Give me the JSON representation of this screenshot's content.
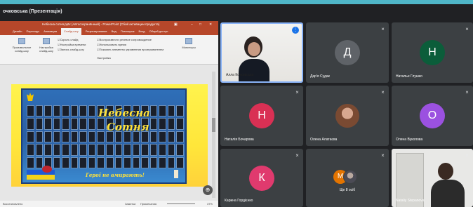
{
  "window": {
    "title": "очковська (Презентація)"
  },
  "powerpoint": {
    "title": "Небесна сотня.pptx (Автосохранённый) - PowerPoint (Сбой активации продукта)",
    "tabs": [
      "Дизайн",
      "Переходы",
      "Анимация",
      "Слайд-шоу",
      "Рецензирование",
      "Вид",
      "Помощник",
      "Вход",
      "Общий доступ"
    ],
    "active_tab": "Слайд-шоу",
    "ribbon": {
      "btn1": "Произвольное слайд-шоу",
      "btn2": "Настройка слайд-шоу",
      "hide_slide": "Скрыть слайд",
      "rehearse": "Настройка времени",
      "record": "Запись слайд-шоу",
      "narrations": "Воспроизвести речевое сопровождение",
      "timings": "Использовать время",
      "controls": "Показать элементы управления проигрывателем",
      "group": "Настройка",
      "monitors": "Мониторы"
    },
    "slide": {
      "caption1": "Небесна",
      "caption2": "Сотня",
      "footer": "Герої не вмирають!"
    },
    "status": {
      "ready": "Восстановлено",
      "notes": "Заметки",
      "comments": "Примечания",
      "zoom": "37%"
    }
  },
  "participants": [
    {
      "name": "Алла Кочковська",
      "type": "camera",
      "speaking": true
    },
    {
      "name": "Дар'я Судак",
      "type": "initial",
      "initial": "Д",
      "color": "#5f6368"
    },
    {
      "name": "Наталье Глушко",
      "type": "initial",
      "initial": "Н",
      "color": "#0b5d3a"
    },
    {
      "name": "Наталія Бочарова",
      "type": "initial",
      "initial": "Н",
      "color": "#d93054"
    },
    {
      "name": "Олена Алатаєва",
      "type": "photo"
    },
    {
      "name": "Олена Вуколова",
      "type": "initial",
      "initial": "О",
      "color": "#9b51e0"
    },
    {
      "name": "Карина Гордієнко",
      "type": "initial",
      "initial": "К",
      "color": "#e03a6e"
    },
    {
      "name": "Ще 8 осіб",
      "type": "more",
      "initial": "М"
    },
    {
      "name": "Nataliy Stepanova",
      "type": "camera2"
    }
  ],
  "icons": {
    "mic_off": "mic-off-icon",
    "speaking": "speaking-icon",
    "zoom": "zoom-icon"
  }
}
